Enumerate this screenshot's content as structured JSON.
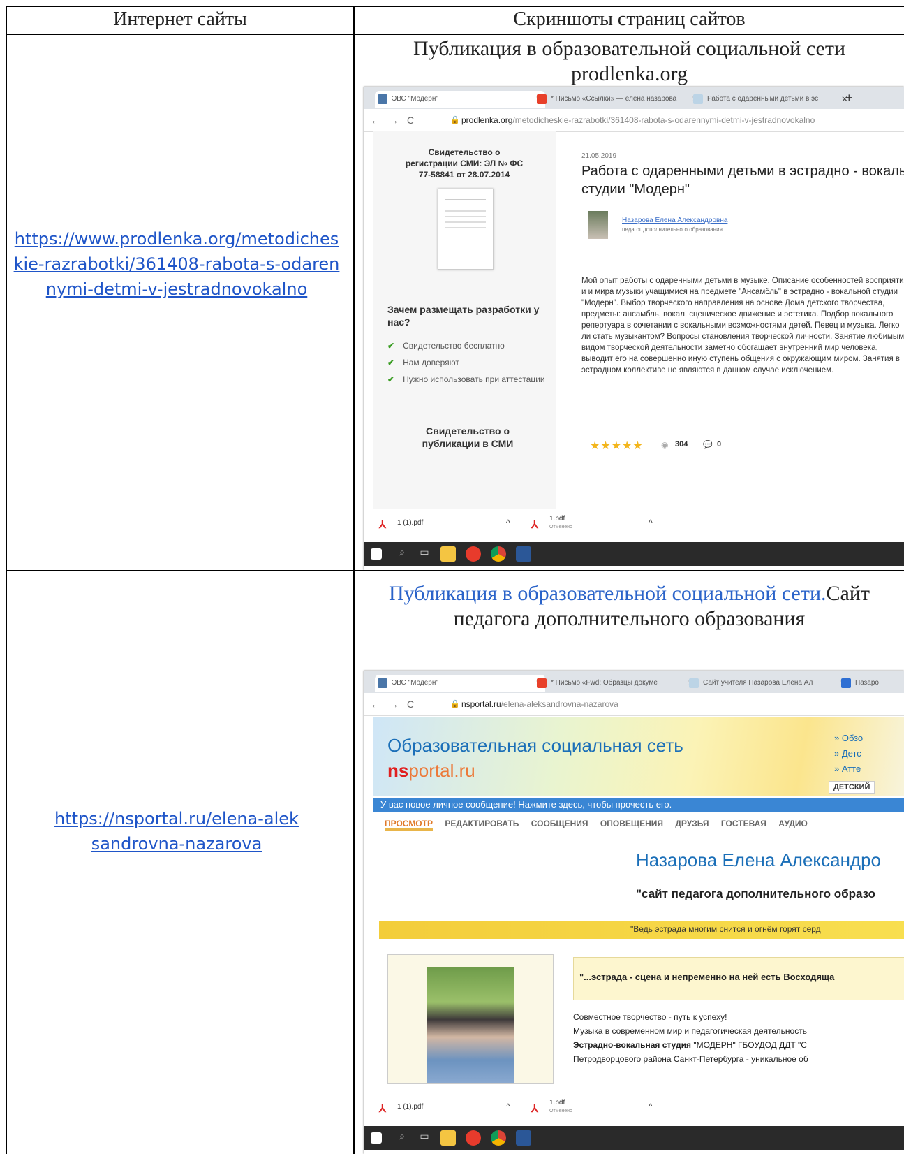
{
  "table": {
    "col1_header": "Интернет сайты",
    "col2_header": "Скриншоты страниц сайтов"
  },
  "row1": {
    "link": "https://www.prodlenka.org/metodicheskie-razrabotki/361408-rabota-s-odarennymi-detmi-v-jestradnovokalno",
    "title": "Публикация в образовательной социальной сети prodlenka.org",
    "shot": {
      "tabs": [
        "ЭВС \"Модерн\"",
        "* Письмо «Ссылки» — елена назарова",
        "Работа с одаренными детьми в эс"
      ],
      "new_tab": "+",
      "url_domain": "prodlenka.org",
      "url_path": "/metodicheskie-razrabotki/361408-rabota-s-odarennymi-detmi-v-jestradnovokalno",
      "cert_reg": "Свидетельство о регистрации СМИ: ЭЛ № ФС 77-58841 от 28.07.2014",
      "why_title": "Зачем размещать разработки у нас?",
      "features": [
        "Свидетельство бесплатно",
        "Нам доверяют",
        "Нужно использовать при аттестации"
      ],
      "pub_cert": "Свидетельство о публикации в СМИ",
      "date": "21.05.2019",
      "article_title": "Работа с одаренными детьми в эстрадно - вокальной студии \"Модерн\"",
      "author": "Назарова Елена Александровна",
      "author_role": "педагог дополнительного образования",
      "body": "Мой опыт работы с одаренными детьми в музыке. Описание особенностей восприятия и и мира музыки учащимися на предмете \"Ансамбль\" в эстрадно - вокальной студии \"Модерн\". Выбор творческого направления на основе Дома детского творчества, предметы: ансамбль, вокал, сценическое движение и эстетика. Подбор вокального репертуара в сочетании с вокальными возможностями детей. Певец и музыка. Легко ли стать музыкантом? Вопросы становления творческой личности. Занятие любимым видом творческой деятельности заметно обогащает внутренний мир человека, выводит его на совершенно иную ступень общения с окружающим миром. Занятия в эстрадном коллективе не являются в данном случае исключением.",
      "views": "304",
      "comments": "0",
      "downloads": [
        {
          "name": "1 (1).pdf",
          "sub": ""
        },
        {
          "name": "1.pdf",
          "sub": "Отменено"
        }
      ]
    }
  },
  "row2": {
    "link": "https://nsportal.ru/elena-aleksandrovna-nazarova",
    "title_blue": "Публикация в образовательной социальной сети.",
    "title_black": "Сайт педагога дополнительного образования",
    "shot": {
      "tabs": [
        "ЭВС \"Модерн\"",
        "* Письмо «Fwd: Образцы докуме",
        "Сайт учителя Назарова Елена Ал",
        "Назаро"
      ],
      "url_domain": "nsportal.ru",
      "url_path": "/elena-aleksandrovna-nazarova",
      "site_title": "Образовательная социальная сеть",
      "logo_ns": "ns",
      "logo_rest": "portal.ru",
      "right_links": [
        "Обзо",
        "Детс",
        "Атте"
      ],
      "kids_button": "ДЕТСКИЙ",
      "notice": "У вас новое личное сообщение! Нажмите здесь, чтобы прочесть его.",
      "menu": [
        "ПРОСМОТР",
        "РЕДАКТИРОВАТЬ",
        "СООБЩЕНИЯ",
        "ОПОВЕЩЕНИЯ",
        "ДРУЗЬЯ",
        "ГОСТЕВАЯ",
        "АУДИО"
      ],
      "name": "Назарова Елена Александро",
      "subtitle": "\"сайт педагога дополнительного образо",
      "quote_banner": "\"Ведь эстрада многим снится и огнём горят серд",
      "box_quote": "\"...эстрада - сцена и непременно на ней есть Восходяща",
      "lines": [
        "Совместное творчество - путь к успеху!",
        "Музыка в современном мир и педагогическая деятельность"
      ],
      "studio_bold": "Эстрадно-вокальная студия",
      "studio_rest": " \"МОДЕРН\" ГБОУДОД ДДТ \"С",
      "studio_line2": "Петродворцового района Санкт-Петербурга - уникальное об",
      "downloads": [
        {
          "name": "1 (1).pdf",
          "sub": ""
        },
        {
          "name": "1.pdf",
          "sub": "Отменено"
        }
      ]
    }
  },
  "colors": {
    "link": "#1f55c8",
    "title_blue": "#2a63c9",
    "ns_red": "#e02020",
    "site_blue": "#1b6fb8",
    "notice_bg": "#3a86d4",
    "star": "#f3b51b"
  }
}
